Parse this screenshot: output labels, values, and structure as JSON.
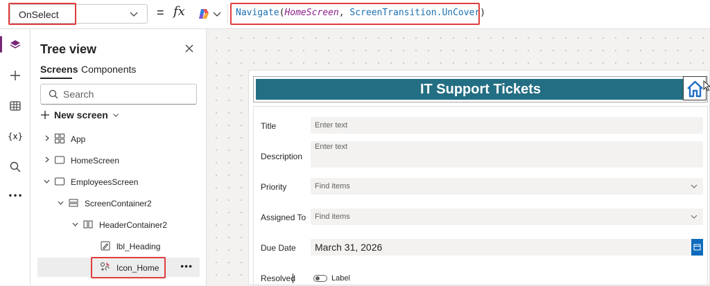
{
  "formula_bar": {
    "property": "OnSelect",
    "equals": "=",
    "fx": "fx",
    "formula": {
      "fn": "Navigate",
      "open": "(",
      "arg1": "HomeScreen",
      "sep": ", ",
      "arg2": "ScreenTransition.UnCover",
      "close": ")"
    }
  },
  "rail": {
    "items": [
      {
        "icon": "layers-icon",
        "active": true
      },
      {
        "icon": "plus-icon"
      },
      {
        "icon": "table-icon"
      },
      {
        "icon": "variables-icon",
        "text": "{x}"
      },
      {
        "icon": "search-icon"
      },
      {
        "icon": "more-icon",
        "text": "•••"
      }
    ]
  },
  "tree_view": {
    "title": "Tree view",
    "tabs": [
      "Screens",
      "Components"
    ],
    "active_tab": "Screens",
    "search_placeholder": "Search",
    "new_screen": "New screen",
    "nodes": [
      {
        "label": "App",
        "icon": "app-icon",
        "level": 0,
        "expanded": false
      },
      {
        "label": "HomeScreen",
        "icon": "screen-icon",
        "level": 0,
        "expanded": false
      },
      {
        "label": "EmployeesScreen",
        "icon": "screen-icon",
        "level": 0,
        "expanded": true
      },
      {
        "label": "ScreenContainer2",
        "icon": "vertical-container-icon",
        "level": 1,
        "expanded": true
      },
      {
        "label": "HeaderContainer2",
        "icon": "horizontal-container-icon",
        "level": 2,
        "expanded": true
      },
      {
        "label": "lbl_Heading",
        "icon": "label-icon",
        "level": 3
      },
      {
        "label": "Icon_Home",
        "icon": "icon-control-icon",
        "level": 3,
        "selected": true,
        "more": "•••"
      }
    ]
  },
  "app_preview": {
    "header_title": "IT Support Tickets",
    "header_color": "#236e83",
    "fields": [
      {
        "label": "Title",
        "placeholder": "Enter text"
      },
      {
        "label": "Description",
        "placeholder": "Enter text"
      },
      {
        "label": "Priority",
        "placeholder": "Find items"
      },
      {
        "label": "Assigned To",
        "placeholder": "Find items"
      },
      {
        "label": "Due Date",
        "value": "March 31, 2026"
      },
      {
        "label": "Resolved",
        "toggle_label": "Label"
      }
    ]
  },
  "colors": {
    "accent_purple": "#742774",
    "highlight_red": "#e03c3c",
    "date_button_blue": "#0f6cbd"
  }
}
